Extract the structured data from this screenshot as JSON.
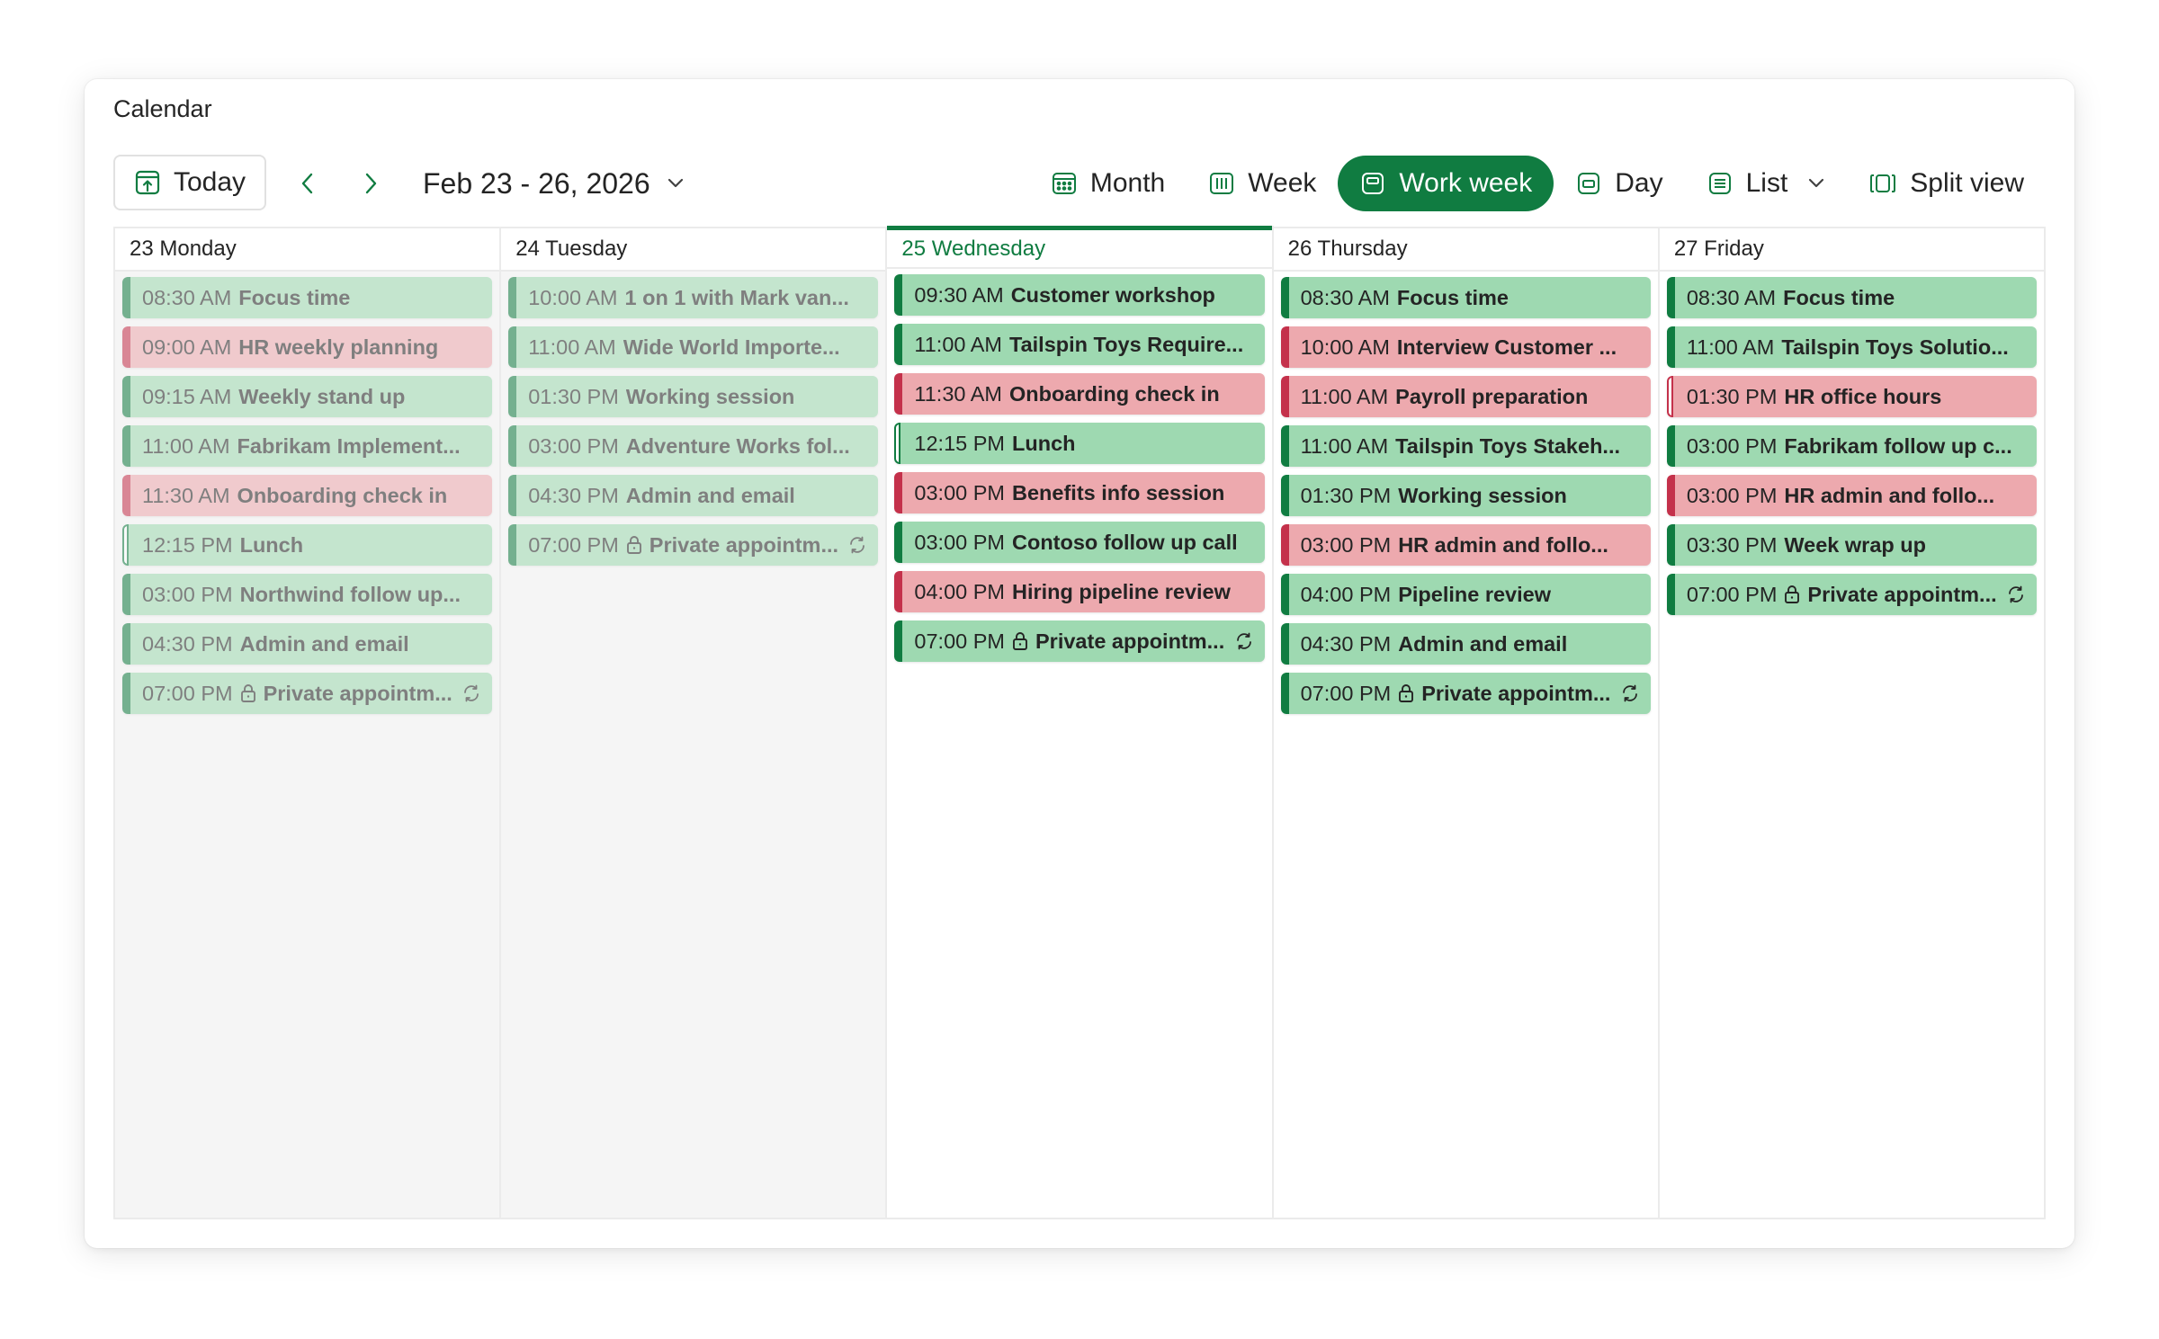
{
  "app": {
    "title": "Calendar"
  },
  "toolbar": {
    "today_label": "Today",
    "date_range": "Feb 23 - 26, 2026",
    "views": [
      {
        "label": "Month",
        "icon": "month-icon"
      },
      {
        "label": "Week",
        "icon": "week-icon"
      },
      {
        "label": "Work week",
        "icon": "work-week-icon",
        "active": true
      },
      {
        "label": "Day",
        "icon": "day-icon"
      },
      {
        "label": "List",
        "icon": "list-icon",
        "dropdown": true
      },
      {
        "label": "Split view",
        "icon": "split-view-icon"
      }
    ]
  },
  "colors": {
    "accent": "#107c41",
    "event_green": "#9ed9b1",
    "event_red": "#eda9ae",
    "bar_green": "#107c41",
    "bar_red": "#c4314b"
  },
  "days": [
    {
      "label": "23 Monday",
      "state": "past",
      "events": [
        {
          "time": "08:30 AM",
          "title": "Focus time",
          "color": "green"
        },
        {
          "time": "09:00 AM",
          "title": "HR weekly planning",
          "color": "red"
        },
        {
          "time": "09:15 AM",
          "title": "Weekly stand up",
          "color": "green"
        },
        {
          "time": "11:00 AM",
          "title": "Fabrikam Implement...",
          "color": "green"
        },
        {
          "time": "11:30 AM",
          "title": "Onboarding check in",
          "color": "red"
        },
        {
          "time": "12:15 PM",
          "title": "Lunch",
          "color": "green",
          "outline": true
        },
        {
          "time": "03:00 PM",
          "title": "Northwind follow up...",
          "color": "green"
        },
        {
          "time": "04:30 PM",
          "title": "Admin and email",
          "color": "green"
        },
        {
          "time": "07:00 PM",
          "title": "Private appointm...",
          "color": "green",
          "private": true,
          "recurring": true
        }
      ]
    },
    {
      "label": "24 Tuesday",
      "state": "past",
      "events": [
        {
          "time": "10:00 AM",
          "title": "1 on 1 with Mark van...",
          "color": "green"
        },
        {
          "time": "11:00 AM",
          "title": "Wide World Importe...",
          "color": "green"
        },
        {
          "time": "01:30 PM",
          "title": "Working session",
          "color": "green"
        },
        {
          "time": "03:00 PM",
          "title": "Adventure Works fol...",
          "color": "green"
        },
        {
          "time": "04:30 PM",
          "title": "Admin and email",
          "color": "green"
        },
        {
          "time": "07:00 PM",
          "title": "Private appointm...",
          "color": "green",
          "private": true,
          "recurring": true
        }
      ]
    },
    {
      "label": "25 Wednesday",
      "state": "today",
      "events": [
        {
          "time": "09:30 AM",
          "title": "Customer workshop",
          "color": "green"
        },
        {
          "time": "11:00 AM",
          "title": "Tailspin Toys Require...",
          "color": "green"
        },
        {
          "time": "11:30 AM",
          "title": "Onboarding check in",
          "color": "red"
        },
        {
          "time": "12:15 PM",
          "title": "Lunch",
          "color": "green",
          "outline": true
        },
        {
          "time": "03:00 PM",
          "title": "Benefits info session",
          "color": "red"
        },
        {
          "time": "03:00 PM",
          "title": "Contoso follow up call",
          "color": "green"
        },
        {
          "time": "04:00 PM",
          "title": "Hiring pipeline review",
          "color": "red"
        },
        {
          "time": "07:00 PM",
          "title": "Private appointm...",
          "color": "green",
          "private": true,
          "recurring": true
        }
      ]
    },
    {
      "label": "26 Thursday",
      "state": "future",
      "events": [
        {
          "time": "08:30 AM",
          "title": "Focus time",
          "color": "green"
        },
        {
          "time": "10:00 AM",
          "title": "Interview Customer ...",
          "color": "red"
        },
        {
          "time": "11:00 AM",
          "title": "Payroll preparation",
          "color": "red"
        },
        {
          "time": "11:00 AM",
          "title": "Tailspin Toys Stakeh...",
          "color": "green"
        },
        {
          "time": "01:30 PM",
          "title": "Working session",
          "color": "green"
        },
        {
          "time": "03:00 PM",
          "title": "HR admin and follo...",
          "color": "red"
        },
        {
          "time": "04:00 PM",
          "title": "Pipeline review",
          "color": "green"
        },
        {
          "time": "04:30 PM",
          "title": "Admin and email",
          "color": "green"
        },
        {
          "time": "07:00 PM",
          "title": "Private appointm...",
          "color": "green",
          "private": true,
          "recurring": true
        }
      ]
    },
    {
      "label": "27 Friday",
      "state": "future",
      "events": [
        {
          "time": "08:30 AM",
          "title": "Focus time",
          "color": "green"
        },
        {
          "time": "11:00 AM",
          "title": "Tailspin Toys Solutio...",
          "color": "green"
        },
        {
          "time": "01:30 PM",
          "title": "HR office hours",
          "color": "red",
          "outline": true
        },
        {
          "time": "03:00 PM",
          "title": "Fabrikam follow up c...",
          "color": "green"
        },
        {
          "time": "03:00 PM",
          "title": "HR admin and follo...",
          "color": "red"
        },
        {
          "time": "03:30 PM",
          "title": "Week wrap up",
          "color": "green"
        },
        {
          "time": "07:00 PM",
          "title": "Private appointm...",
          "color": "green",
          "private": true,
          "recurring": true
        }
      ]
    }
  ]
}
